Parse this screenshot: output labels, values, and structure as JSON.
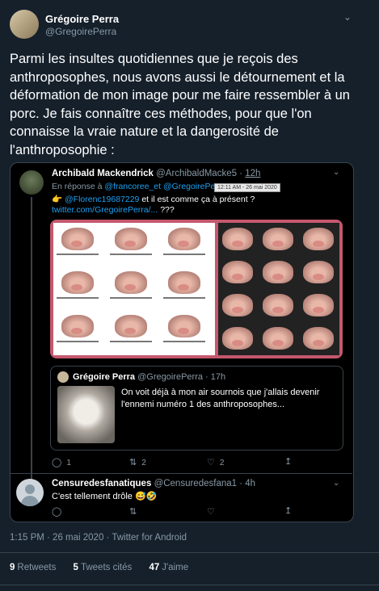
{
  "main_tweet": {
    "author_name": "Grégoire Perra",
    "author_handle": "@GregoirePerra",
    "text": "Parmi les insultes quotidiennes que je reçois des anthroposophes, nous avons aussi le détournement et la déformation de mon image pour me faire ressembler à un porc. Je fais connaître ces méthodes,  pour que l'on connaisse la vraie nature et la dangerosité de l'anthroposophie :",
    "timestamp": "1:15 PM · 26 mai 2020 · Twitter for Android",
    "stats": {
      "retweets_count": "9",
      "retweets_label": "Retweets",
      "quotes_count": "5",
      "quotes_label": "Tweets cités",
      "likes_count": "47",
      "likes_label": "J'aime"
    }
  },
  "quoted": {
    "author_name": "Archibald Mackendrick",
    "author_handle": "@ArchibaldMacke5",
    "time": "12h",
    "reply_prefix": "En réponse à",
    "reply_to_1": "@francoree_et",
    "reply_to_2": "@GregoirePerra",
    "tooltip": "12:11 AM - 26 mai 2020",
    "pointer_emoji": "👉",
    "mention": "@Florenc19687229",
    "line3_text": "et il est comme ça à présent ?",
    "link": "twitter.com/GregoirePerra/...",
    "link_suffix": " ???",
    "actions": {
      "replies": "1",
      "retweets": "2",
      "likes": "2"
    }
  },
  "nested": {
    "author_name": "Grégoire Perra",
    "author_handle": "@GregoirePerra",
    "time": "· 17h",
    "text": "On voit déjà à mon air sournois que j'allais devenir l'ennemi numéro 1 des anthroposophes..."
  },
  "comment": {
    "author_name": "Censuredesfanatiques",
    "author_handle": "@Censuredesfana1",
    "time": "· 4h",
    "text": "C'est tellement drôle 😅🤣"
  },
  "icons": {
    "reply": "reply-icon",
    "retweet": "retweet-icon",
    "like": "heart-icon",
    "share": "share-icon",
    "chevron": "chevron-down-icon"
  }
}
